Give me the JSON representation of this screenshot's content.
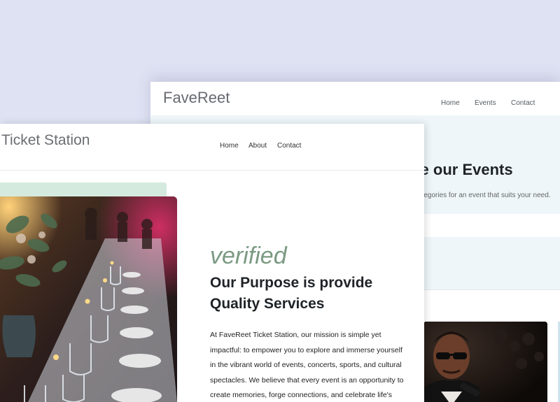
{
  "back_site": {
    "brand": "FaveReet",
    "nav": [
      "Home",
      "Events",
      "Contact"
    ],
    "hero_title": "re our Events",
    "hero_subtitle": "categories for an event that suits your need."
  },
  "front_site": {
    "brand": "Ticket Station",
    "nav": [
      "Home",
      "About",
      "Contact"
    ],
    "tagline": "verified",
    "heading": "Our Purpose is provide Quality Services",
    "body": "At FaveReet Ticket Station, our mission is simple yet impactful: to empower you to explore and immerse yourself in the vibrant world of events, concerts, sports, and cultural spectacles. We believe that every event is an opportunity to create memories, forge connections, and celebrate life's moments."
  },
  "colors": {
    "page_bg": "#dfe2f3",
    "hero_bg": "#eef6f9",
    "accent_green": "#7a9a82",
    "green_bar": "#d5eadf"
  }
}
